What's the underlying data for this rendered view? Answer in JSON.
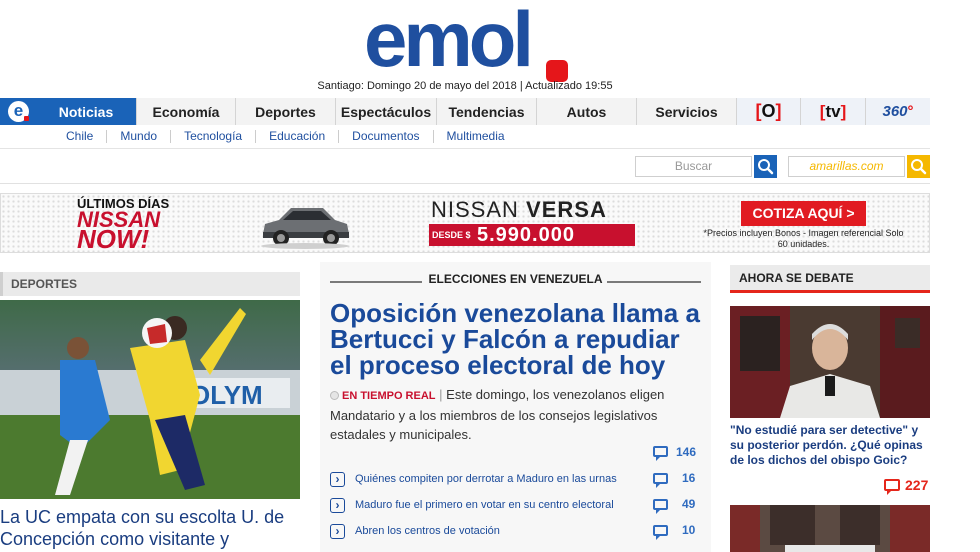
{
  "header": {
    "logo_text": "emol",
    "dateline": "Santiago: Domingo 20 de mayo del 2018 | Actualizado 19:55"
  },
  "nav": {
    "home_icon": "e",
    "items": [
      "Noticias",
      "Economía",
      "Deportes",
      "Espectáculos",
      "Tendencias",
      "Autos",
      "Servicios"
    ],
    "active": "Noticias",
    "brands": [
      "[O]",
      "[tv]",
      "360°"
    ]
  },
  "subnav": [
    "Chile",
    "Mundo",
    "Tecnología",
    "Educación",
    "Documentos",
    "Multimedia"
  ],
  "search": {
    "placeholder": "Buscar",
    "amarillas_placeholder": "amarillas.com"
  },
  "ad": {
    "line1": "ÚLTIMOS DÍAS",
    "line2": "NISSAN",
    "line3": "NOW!",
    "model_prefix": "NISSAN",
    "model": "VERSA",
    "desde": "DESDE $",
    "price": "5.990.000",
    "cta": "COTIZA AQUÍ >",
    "fine_print": "*Precios incluyen Bonos - Imagen referencial Solo 60 unidades."
  },
  "left": {
    "section": "DEPORTES",
    "title": "La UC empata con su escolta U. de Concepción como visitante y"
  },
  "center": {
    "section": "ELECCIONES EN VENEZUELA",
    "title": "Oposición venezolana llama a Bertucci y Falcón a repudiar el proceso electoral de hoy",
    "live_label": "EN TIEMPO REAL",
    "body": "Este domingo, los venezolanos eligen Mandatario y a los miembros de los consejos legislativos estadales y municipales.",
    "main_comments": "146",
    "related": [
      {
        "text": "Quiénes compiten por derrotar a Maduro en las urnas",
        "comments": "16"
      },
      {
        "text": "Maduro fue el primero en votar en su centro electoral",
        "comments": "49"
      },
      {
        "text": "Abren los centros de votación",
        "comments": "10"
      }
    ]
  },
  "right": {
    "section": "AHORA SE DEBATE",
    "title": "\"No estudié para ser detective\" y su posterior perdón. ¿Qué opinas de los dichos del obispo Goic?",
    "comments": "227"
  },
  "colors": {
    "brand_blue": "#1a63b8",
    "brand_red": "#e5161a",
    "headline_blue": "#1a4a9a"
  }
}
